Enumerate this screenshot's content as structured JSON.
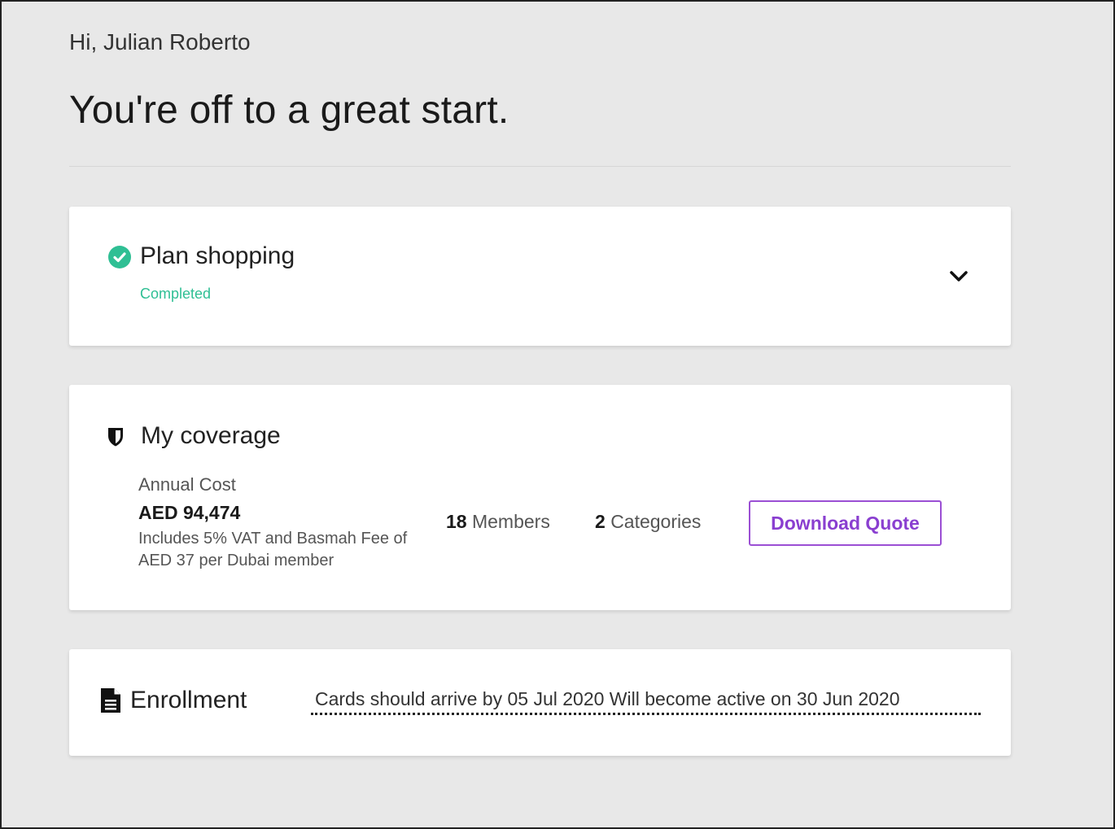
{
  "header": {
    "greeting": "Hi, Julian Roberto",
    "headline": "You're off to a great start."
  },
  "plan_shopping": {
    "icon": "check-circle-icon",
    "title": "Plan shopping",
    "status": "Completed",
    "toggle_icon": "chevron-down-icon"
  },
  "coverage": {
    "icon": "shield-icon",
    "title": "My coverage",
    "annual_cost_label": "Annual Cost",
    "annual_cost_value": "AED 94,474",
    "cost_note": "Includes 5% VAT and Basmah Fee of AED 37 per Dubai member",
    "members_count": "18",
    "members_label": "Members",
    "categories_count": "2",
    "categories_label": "Categories",
    "download_label": "Download Quote"
  },
  "enrollment": {
    "icon": "document-icon",
    "title": "Enrollment",
    "info": "Cards should arrive by 05 Jul 2020 Will become active on 30 Jun 2020"
  },
  "colors": {
    "background": "#e8e8e8",
    "card": "#ffffff",
    "success": "#2fbf94",
    "accent": "#8a3fd0",
    "text": "#222222"
  }
}
